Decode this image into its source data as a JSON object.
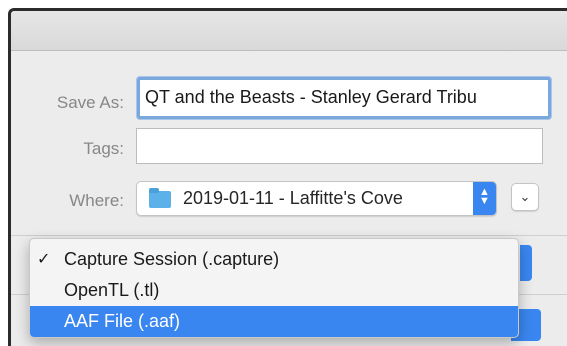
{
  "dialog": {
    "save_as_label": "Save As:",
    "save_as_value": "QT and the Beasts - Stanley Gerard Tribu",
    "tags_label": "Tags:",
    "tags_value": "",
    "where_label": "Where:",
    "where_value": "2019-01-11 - Laffitte's Cove",
    "where_icon": "folder-icon",
    "stepper_icon": "up-down-stepper-icon",
    "expand_icon": "chevron-down-icon"
  },
  "format_menu": {
    "items": [
      {
        "label": "Capture Session (.capture)",
        "checked": true,
        "highlighted": false
      },
      {
        "label": "OpenTL (.tl)",
        "checked": false,
        "highlighted": false
      },
      {
        "label": "AAF File (.aaf)",
        "checked": false,
        "highlighted": true
      }
    ],
    "check_glyph": "✓"
  },
  "colors": {
    "accent": "#3a86f0",
    "focus_ring": "#7aa7dc",
    "folder": "#5cb1e8",
    "label_gray": "#878787"
  }
}
